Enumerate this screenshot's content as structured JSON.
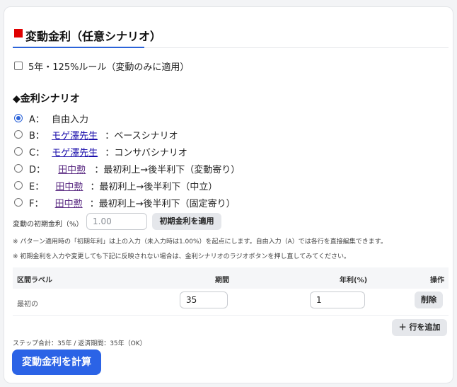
{
  "section": {
    "title": "変動金利（任意シナリオ）"
  },
  "rule_checkbox": {
    "label": "5年・125%ルール（変動のみに適用）",
    "checked": false
  },
  "scenario_heading": "◆金利シナリオ",
  "scenarios": [
    {
      "key": "A：",
      "link": "",
      "desc": "自由入力",
      "checked": true
    },
    {
      "key": "B：",
      "link": "モゲ澤先生",
      "desc": "：ベースシナリオ",
      "checked": false
    },
    {
      "key": "C：",
      "link": "モゲ澤先生",
      "desc": "：コンサバシナリオ",
      "checked": false
    },
    {
      "key": "D：",
      "link": "田中勲",
      "desc": "：最初利上→後半利下（変動寄り）",
      "checked": false
    },
    {
      "key": "E：",
      "link": "田中勲",
      "desc": "：最初利上→後半利下（中立）",
      "checked": false
    },
    {
      "key": "F：",
      "link": "田中勲",
      "desc": "：最初利上→後半利下（固定寄り）",
      "checked": false
    }
  ],
  "initial_rate": {
    "label": "変動の初期金利（%）",
    "placeholder": "1.00",
    "apply_label": "初期金利を適用"
  },
  "notes": [
    "※ パターン適用時の「初期年利」は上の入力（未入力時は1.00%）を起点にします。自由入力（A）では各行を直接編集できます。",
    "※ 初期金利を入力や変更しても下記に反映されない場合は、金利シナリオのラジオボタンを押し直してみてください。"
  ],
  "table": {
    "headers": {
      "label": "区間ラベル",
      "period": "期間",
      "rate": "年利(%)",
      "action": "操作"
    },
    "rows": [
      {
        "label": "最初の",
        "period": "35",
        "rate": "1",
        "delete_label": "削除"
      }
    ]
  },
  "add_row_label": "＋ 行を追加",
  "summary": "ステップ合計：35年 / 返済期間：35年（OK）",
  "calc_button": "変動金利を計算",
  "colors": {
    "accent": "#2b63e6",
    "title_marker": "#e00000",
    "link": "#1a0dab"
  }
}
